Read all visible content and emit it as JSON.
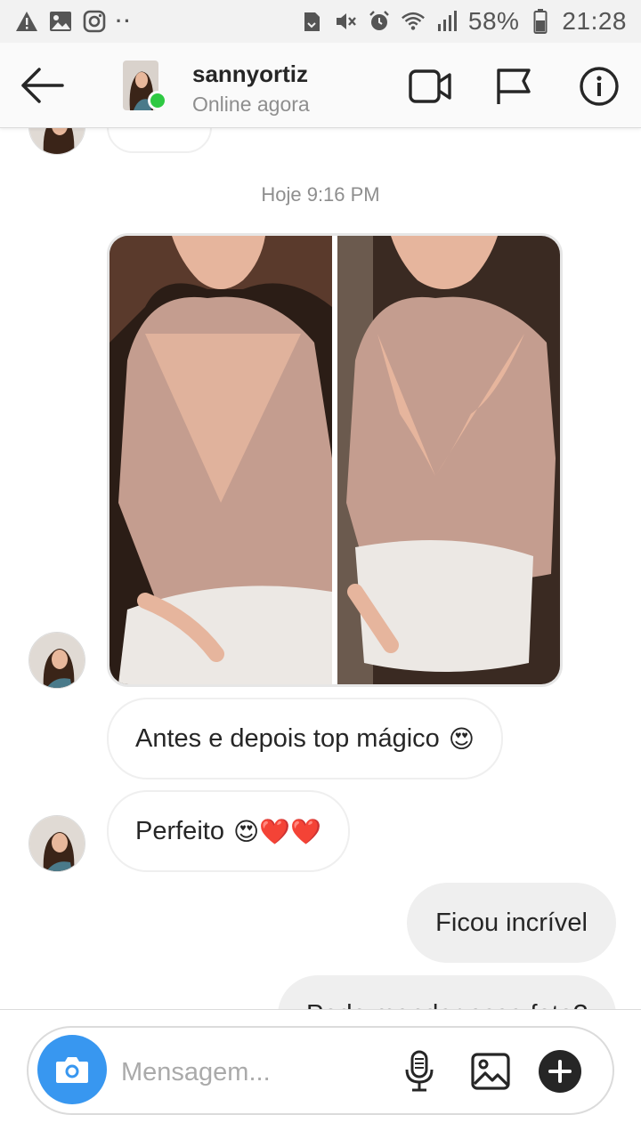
{
  "status_bar": {
    "battery": "58%",
    "time": "21:28",
    "left_icons": [
      "warning-icon",
      "image-icon",
      "instagram-icon"
    ],
    "right_icons": [
      "save-icon",
      "mute-icon",
      "alarm-icon",
      "wifi-icon",
      "signal-icon",
      "battery-icon"
    ]
  },
  "header": {
    "username": "sannyortiz",
    "status": "Online agora"
  },
  "chat": {
    "timestamp": "Hoje 9:16 PM",
    "messages": [
      {
        "type": "photo",
        "direction": "in",
        "alt": "Antes e depois"
      },
      {
        "type": "text",
        "direction": "in",
        "text": "Antes e depois top mágico",
        "emoji": "😍"
      },
      {
        "type": "text",
        "direction": "in",
        "text": "Perfeito",
        "emoji": "😍❤️❤️"
      },
      {
        "type": "text",
        "direction": "out",
        "text": "Ficou incrível"
      },
      {
        "type": "text",
        "direction": "out",
        "text": "Pode mandar essa foto?"
      }
    ]
  },
  "composer": {
    "placeholder": "Mensagem..."
  },
  "colors": {
    "accent": "#3897f0",
    "online": "#2ec942",
    "bubble_out": "#efefef",
    "muted_text": "#8e8e8e"
  }
}
